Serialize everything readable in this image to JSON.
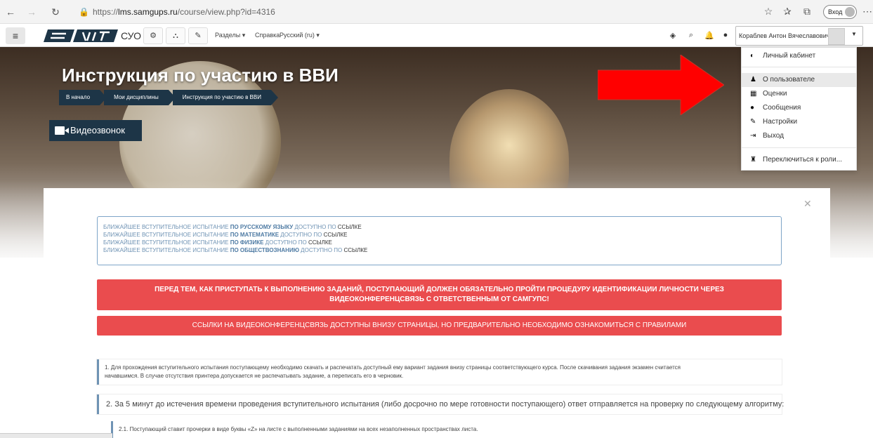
{
  "browser": {
    "url_prefix": "https://",
    "url_host": "lms.samgups.ru",
    "url_path": "/course/view.php?id=4316",
    "login_label": "Вход"
  },
  "navbar": {
    "site_name": "СУО",
    "sections_label": "Разделы",
    "help_label": "Справка",
    "language_label": "Русский (ru)",
    "user_name": "Кораблев Антон Вячеславович"
  },
  "hero": {
    "title": "Инструкция по участию в ВВИ",
    "breadcrumb": [
      "В начало",
      "Мои дисциплины",
      "Инструкция по участию в ВВИ"
    ],
    "video_button": "Видеозвонок"
  },
  "user_menu": {
    "items": [
      {
        "label": "Личный кабинет",
        "icon": "dashboard-icon"
      },
      {
        "label": "О пользователе",
        "icon": "user-icon"
      },
      {
        "label": "Оценки",
        "icon": "grades-table-icon"
      },
      {
        "label": "Сообщения",
        "icon": "message-bubble-icon"
      },
      {
        "label": "Настройки",
        "icon": "wrench-icon"
      },
      {
        "label": "Выход",
        "icon": "logout-icon"
      },
      {
        "label": "Переключиться к роли...",
        "icon": "user-secret-icon"
      }
    ]
  },
  "notice": {
    "lines": [
      {
        "pre": "БЛИЖАЙШЕЕ ВСТУПИТЕЛЬНОЕ ИСПЫТАНИЕ ",
        "bold": "ПО РУССКОМУ ЯЗЫКУ",
        "mid": " ДОСТУПНО ПО ",
        "link": "ССЫЛКЕ"
      },
      {
        "pre": "БЛИЖАЙШЕЕ ВСТУПИТЕЛЬНОЕ ИСПЫТАНИЕ ",
        "bold": "ПО МАТЕМАТИКЕ",
        "mid": " ДОСТУПНО ПО ",
        "link": "ССЫЛКЕ"
      },
      {
        "pre": "БЛИЖАЙШЕЕ ВСТУПИТЕЛЬНОЕ ИСПЫТАНИЕ ",
        "bold": "ПО ФИЗИКЕ",
        "mid": " ДОСТУПНО ПО ",
        "link": "ССЫЛКЕ"
      },
      {
        "pre": "БЛИЖАЙШЕЕ ВСТУПИТЕЛЬНОЕ ИСПЫТАНИЕ ",
        "bold": "ПО ОБЩЕСТВОЗНАНИЮ",
        "mid": " ДОСТУПНО ПО ",
        "link": "ССЫЛКЕ"
      }
    ]
  },
  "banners": {
    "identification_line1": "ПЕРЕД ТЕМ, КАК ПРИСТУПАТЬ К ВЫПОЛНЕНИЮ ЗАДАНИЙ, ПОСТУПАЮЩИЙ ДОЛЖЕН ОБЯЗАТЕЛЬНО ПРОЙТИ ПРОЦЕДУРУ ИДЕНТИФИКАЦИИ ЛИЧНОСТИ ЧЕРЕЗ",
    "identification_line2": "ВИДЕОКОНФЕРЕНЦСВЯЗЬ С ОТВЕТСТВЕННЫМ ОТ САМГУПС!",
    "links_info": "ССЫЛКИ НА ВИДЕОКОНФЕРЕНЦСВЯЗЬ ДОСТУПНЫ ВНИЗУ СТРАНИЦЫ, НО ПРЕДВАРИТЕЛЬНО НЕОБХОДИМО ОЗНАКОМИТЬСЯ С ПРАВИЛАМИ"
  },
  "steps": {
    "step1_line1": "1. Для прохождения вступительного испытания поступающему необходимо скачать и распечатать доступный ему вариант задания внизу страницы соответствующего курса. После скачивания задания экзамен считается",
    "step1_line2": "начавшимся. В случае отсутствия принтера допускается не распечатывать задание, а переписать его в черновик.",
    "step2": "2. За 5 минут до истечения времени проведения вступительного испытания (либо досрочно по мере готовности поступающего) ответ отправляется на проверку по следующему алгоритму:",
    "step2_1": "2.1. Поступающий ставит прочерки в виде буквы «Z» на листе с выполненными заданиями на всех незаполненных пространствах листа."
  },
  "colors": {
    "breadcrumb_bg": "#1d3547",
    "banner_red": "#ea4c4e",
    "arrow_red": "#ff0000",
    "notice_text": "#6f93b4"
  }
}
